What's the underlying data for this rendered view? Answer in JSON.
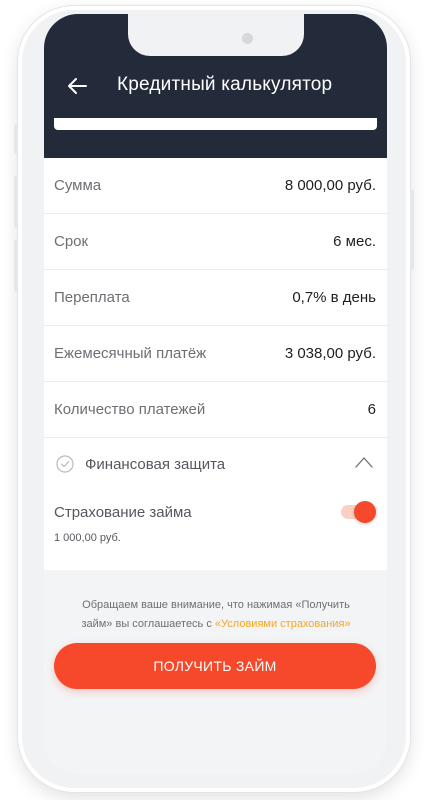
{
  "header": {
    "title": "Кредитный калькулятор",
    "back_icon": "arrow-left-icon",
    "background": "#232a39"
  },
  "summary": {
    "rows": [
      {
        "label": "Сумма",
        "value": "8 000,00 руб."
      },
      {
        "label": "Срок",
        "value": "6 мес."
      },
      {
        "label": "Переплата",
        "value": "0,7% в день"
      },
      {
        "label": "Ежемесячный платёж",
        "value": "3 038,00 руб."
      },
      {
        "label": "Количество платежей",
        "value": "6"
      }
    ]
  },
  "financial_protection": {
    "title": "Финансовая защита",
    "check_icon": "check-circle-icon",
    "collapse_icon": "chevron-up-icon",
    "insurance_label": "Страхование займа",
    "insurance_amount": "1 000,00 руб.",
    "insurance_enabled": true
  },
  "notice": {
    "text": "Обращаем ваше внимание, что нажимая «Получить займ» вы соглашаетесь с",
    "link": "«Условиями страхования»"
  },
  "cta": {
    "label": "ПОЛУЧИТЬ ЗАЙМ",
    "color": "#f6482a"
  },
  "accent_colors": {
    "primary": "#f6482a",
    "link": "#f5a623"
  }
}
